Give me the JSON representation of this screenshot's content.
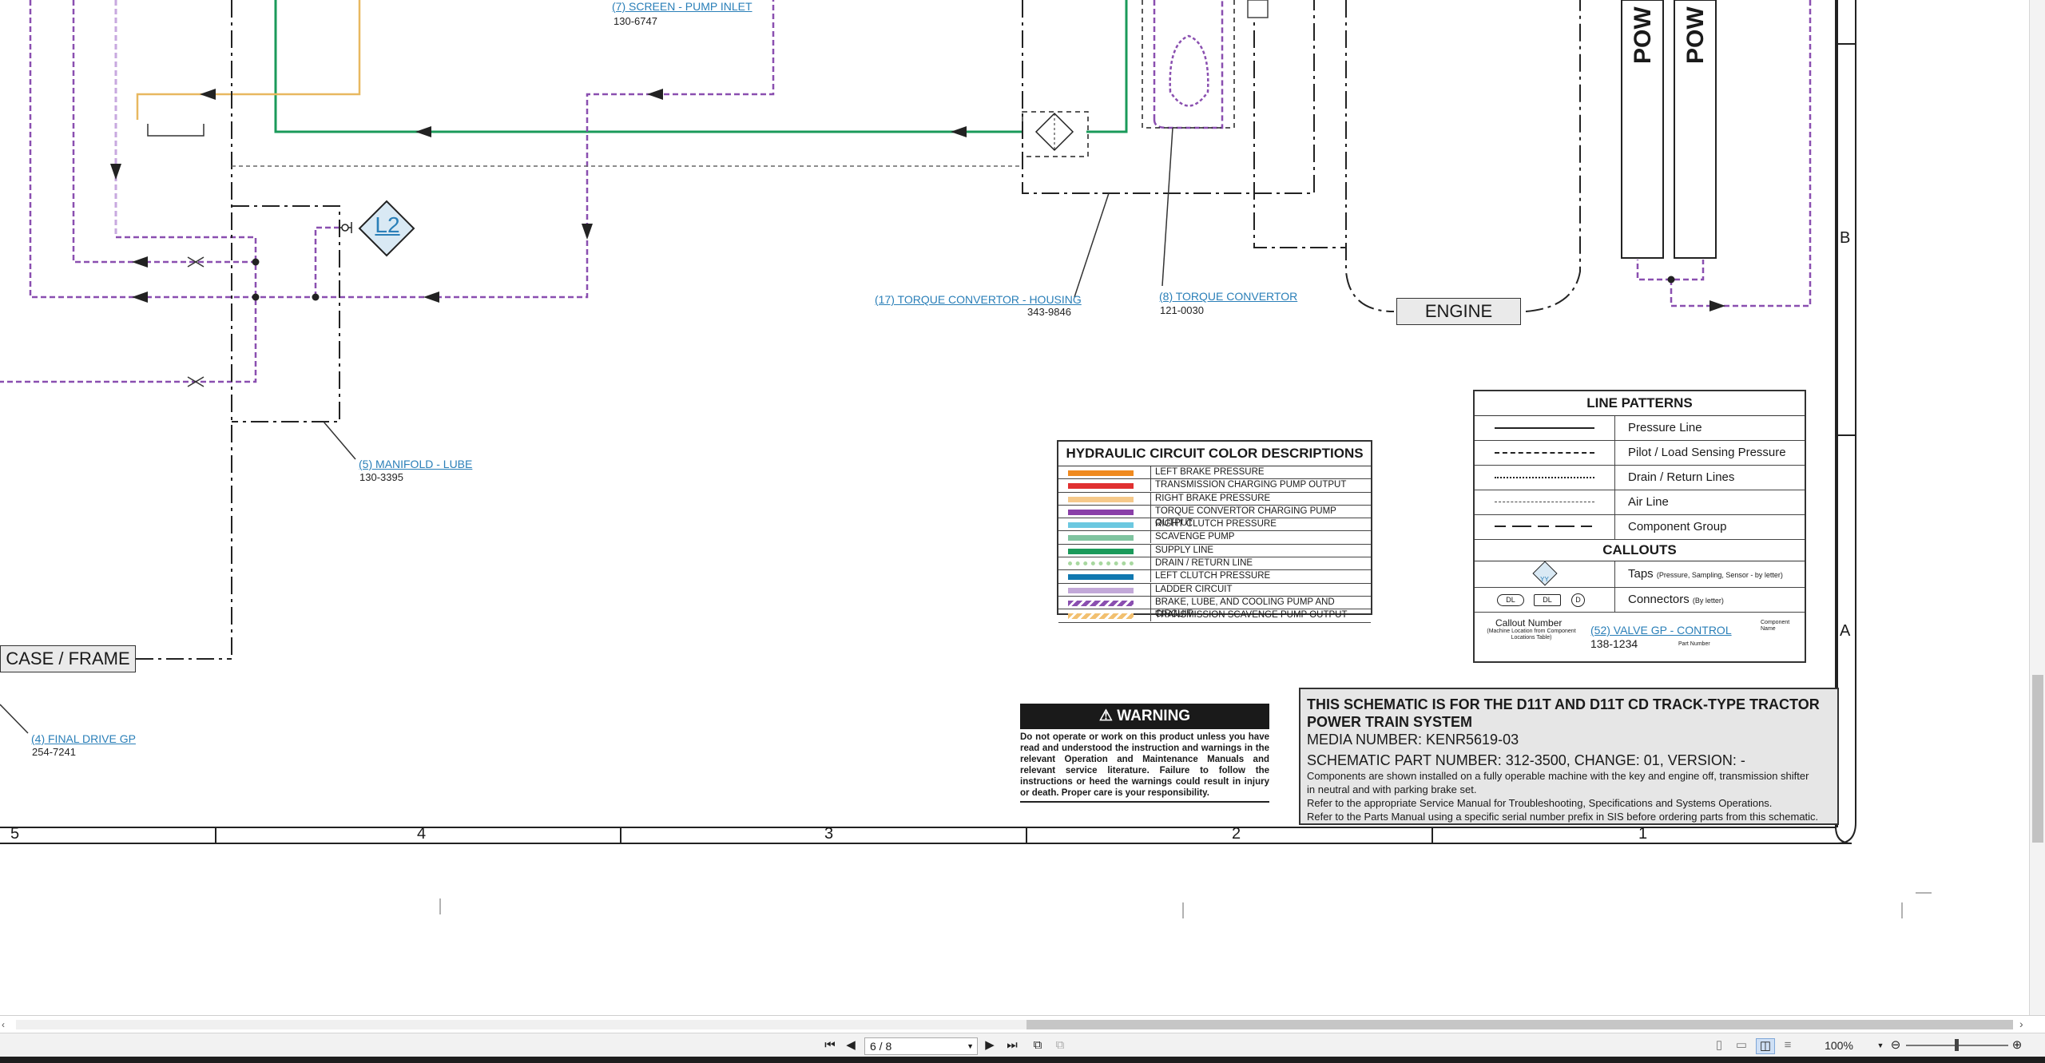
{
  "callouts": {
    "screen_pump_inlet": {
      "label": "(7) SCREEN - PUMP INLET",
      "part": "130-6747"
    },
    "torque_convertor_housing": {
      "label": "(17) TORQUE CONVERTOR - HOUSING",
      "part": "343-9846"
    },
    "torque_convertor": {
      "label": "(8) TORQUE CONVERTOR",
      "part": "121-0030"
    },
    "manifold_lube": {
      "label": "(5) MANIFOLD - LUBE",
      "part": "130-3395"
    },
    "final_drive": {
      "label": "(4) FINAL DRIVE GP",
      "part": "254-7241"
    }
  },
  "components": {
    "tap_label": "L2",
    "engine": "ENGINE",
    "case_frame": "CASE / FRAME",
    "pow1": "POW",
    "pow2": "POW"
  },
  "grid": {
    "columns": [
      "5",
      "4",
      "3",
      "2",
      "1"
    ],
    "rows": [
      "B",
      "A"
    ]
  },
  "color_legend": {
    "title": "HYDRAULIC CIRCUIT COLOR DESCRIPTIONS",
    "items": [
      {
        "label": "LEFT BRAKE PRESSURE",
        "color": "#f08a1f",
        "style": "solid"
      },
      {
        "label": "TRANSMISSION CHARGING PUMP OUTPUT",
        "color": "#e03030",
        "style": "solid"
      },
      {
        "label": "RIGHT BRAKE PRESSURE",
        "color": "#f6c98a",
        "style": "solid"
      },
      {
        "label": "TORQUE CONVERTOR CHARGING PUMP OUTPUT",
        "color": "#8a3fa8",
        "style": "solid"
      },
      {
        "label": "RIGHT CLUTCH PRESSURE",
        "color": "#6cc8e0",
        "style": "solid"
      },
      {
        "label": "SCAVENGE PUMP",
        "color": "#7fc4a0",
        "style": "solid"
      },
      {
        "label": "SUPPLY LINE",
        "color": "#1a9a5a",
        "style": "solid"
      },
      {
        "label": "DRAIN / RETURN LINE",
        "color": "#a8d8a0",
        "style": "dotted"
      },
      {
        "label": "LEFT CLUTCH PRESSURE",
        "color": "#1078b0",
        "style": "solid"
      },
      {
        "label": "LADDER CIRCUIT",
        "color": "#c2a8d8",
        "style": "solid"
      },
      {
        "label": "BRAKE, LUBE, AND COOLING PUMP AND CIRCUIT",
        "color": "#8a4fb0",
        "style": "striped"
      },
      {
        "label": "TRANSMISSION SCAVENGE PUMP OUTPUT",
        "color": "#f2c070",
        "style": "striped"
      }
    ]
  },
  "line_patterns": {
    "title": "LINE PATTERNS",
    "items": [
      {
        "label": "Pressure Line",
        "dash": "solid"
      },
      {
        "label": "Pilot / Load Sensing Pressure",
        "dash": "dashed"
      },
      {
        "label": "Drain / Return Lines",
        "dash": "dotted"
      },
      {
        "label": "Air Line",
        "dash": "fine"
      },
      {
        "label": "Component Group",
        "dash": "dashdot"
      }
    ],
    "callouts_title": "CALLOUTS",
    "taps_label": "Taps",
    "taps_note": "(Pressure, Sampling, Sensor - by letter)",
    "tap_icon_text": "YY",
    "connectors_label": "Connectors",
    "connectors_note": "(By letter)",
    "connector_icons": [
      "DL",
      "DL",
      "D"
    ],
    "example_callout_number_label": "Callout Number",
    "example_callout_number_note": "(Machine Location from Component Locations Table)",
    "example_callout": "(52) VALVE GP - CONTROL",
    "example_part": "138-1234",
    "example_component_name": "Component Name",
    "example_part_number": "Part Number"
  },
  "warning": {
    "title": "WARNING",
    "text": "Do not operate or work on this product unless you have read and understood the instruction and warnings in the relevant Operation and Maintenance Manuals and relevant service literature. Failure to follow the instructions or heed the warnings could result in injury or death. Proper care is your responsibility."
  },
  "title_block": {
    "line1": "THIS SCHEMATIC IS FOR THE D11T AND D11T CD TRACK-TYPE TRACTOR",
    "line2": "POWER TRAIN SYSTEM",
    "media": "MEDIA NUMBER: KENR5619-03",
    "part": "SCHEMATIC PART NUMBER: 312-3500, CHANGE: 01, VERSION: -",
    "note1": "Components are shown installed on a fully operable machine with the key and engine off, transmission shifter",
    "note1b": "in neutral and with parking brake set.",
    "note2": "Refer to the appropriate Service Manual for Troubleshooting, Specifications and Systems Operations.",
    "note3": "Refer to the Parts Manual using a specific serial number prefix in SIS before ordering parts from this schematic."
  },
  "toolbar": {
    "page_value": "6 / 8",
    "zoom": "100%"
  },
  "colors": {
    "supply": "#1a9a5a",
    "purple": "#8a4fb0",
    "purple_light": "#c8a8e0",
    "tan": "#e8b860",
    "callout_blue": "#2a7fb8"
  }
}
